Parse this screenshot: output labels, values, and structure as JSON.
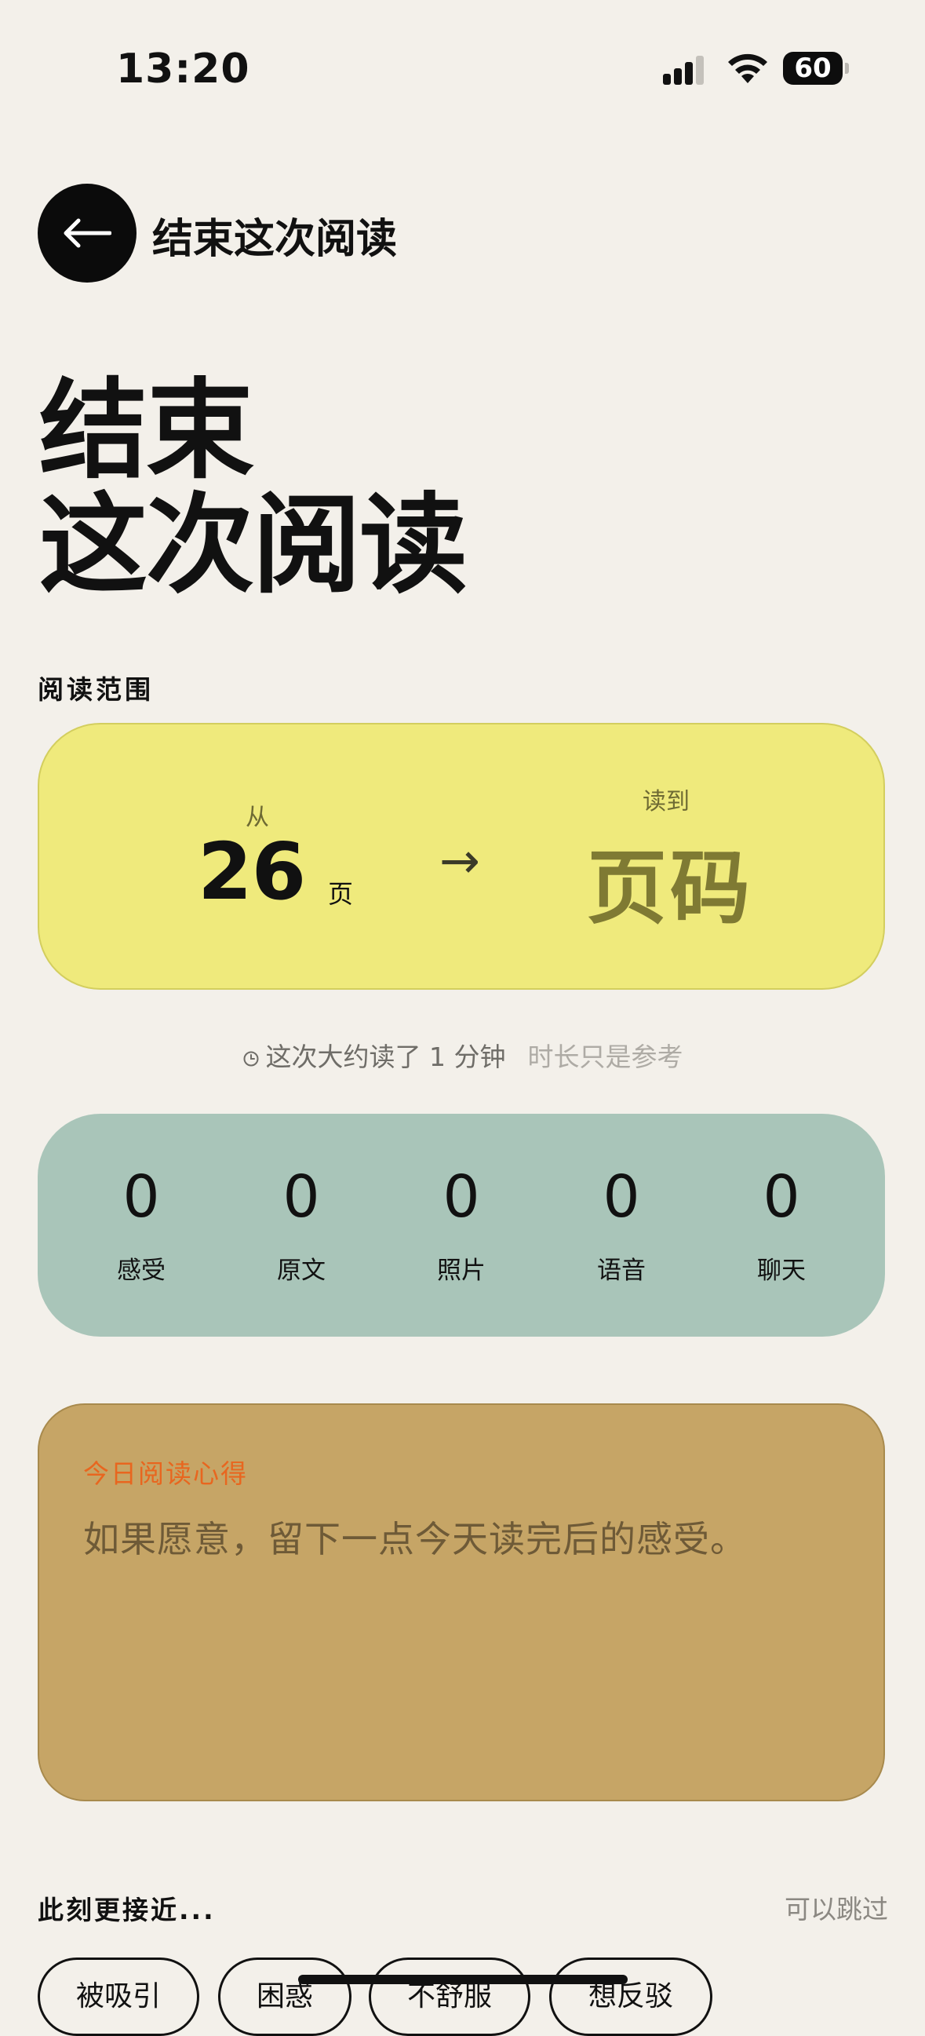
{
  "status_bar": {
    "time": "13:20",
    "battery": "60"
  },
  "header": {
    "back_icon": "arrow-left-icon",
    "title": "结束这次阅读"
  },
  "page_title": {
    "line1": "结束",
    "line2": "这次阅读"
  },
  "range": {
    "section_label": "阅读范围",
    "from_label": "从",
    "from_value": "26",
    "from_unit": "页",
    "arrow": "→",
    "to_label": "读到",
    "to_placeholder": "页码"
  },
  "duration": {
    "icon": "clock-icon",
    "text": "这次大约读了 1 分钟",
    "hint": "时长只是参考"
  },
  "counts": [
    {
      "value": "0",
      "label": "感受"
    },
    {
      "value": "0",
      "label": "原文"
    },
    {
      "value": "0",
      "label": "照片"
    },
    {
      "value": "0",
      "label": "语音"
    },
    {
      "value": "0",
      "label": "聊天"
    }
  ],
  "note": {
    "label": "今日阅读心得",
    "placeholder": "如果愿意，留下一点今天读完后的感受。"
  },
  "mood": {
    "title": "此刻更接近...",
    "skip": "可以跳过",
    "chips": [
      "被吸引",
      "困惑",
      "不舒服",
      "想反驳"
    ]
  },
  "colors": {
    "background": "#f3f0ea",
    "range_card": "#efea7c",
    "counts_card": "#a9c5b9",
    "note_card": "#c6a566",
    "note_label": "#e8661f"
  }
}
